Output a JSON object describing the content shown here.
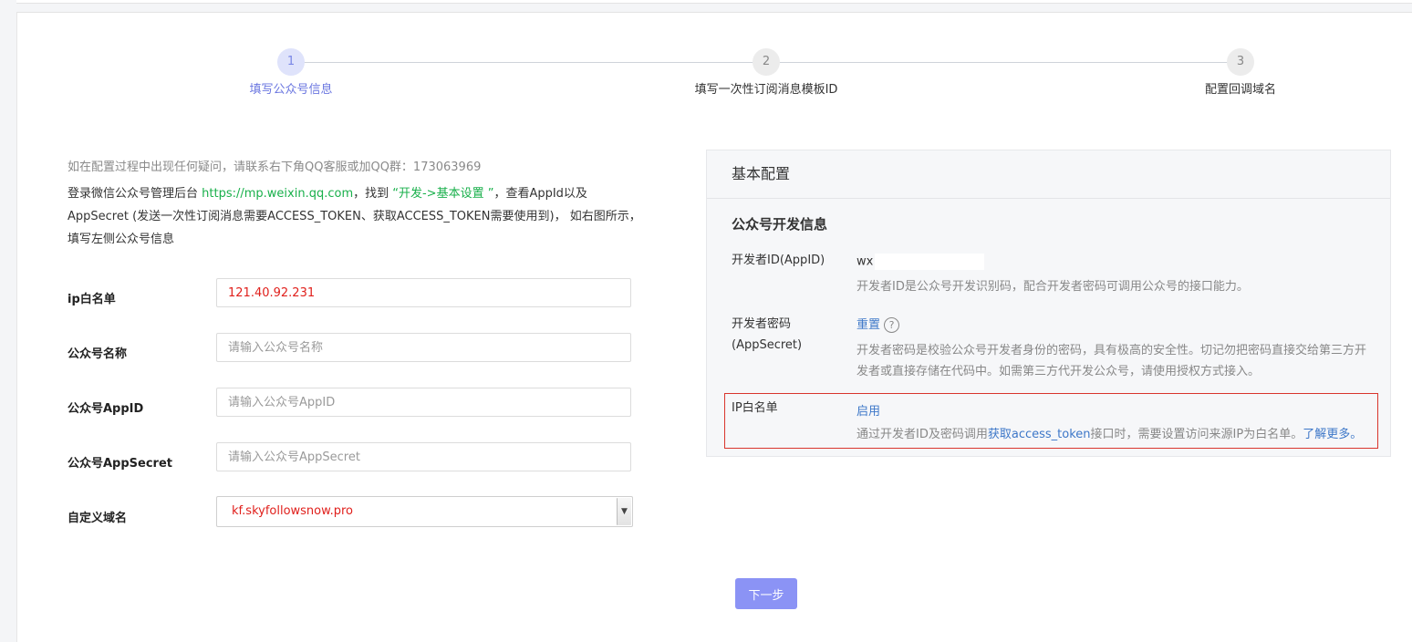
{
  "steps": [
    {
      "number": "1",
      "label": "填写公众号信息"
    },
    {
      "number": "2",
      "label": "填写一次性订阅消息模板ID"
    },
    {
      "number": "3",
      "label": "配置回调域名"
    }
  ],
  "help_text": "如在配置过程中出现任何疑问，请联系右下角QQ客服或加QQ群：173063969",
  "instructions": {
    "prefix": "登录微信公众号管理后台 ",
    "url": "https://mp.weixin.qq.com",
    "middle": "，找到 ",
    "path": "“开发->基本设置 ”",
    "suffix": "，查看AppId以及AppSecret (发送一次性订阅消息需要ACCESS_TOKEN、获取ACCESS_TOKEN需要使用到)， 如右图所示，填写左侧公众号信息"
  },
  "form": {
    "ip_whitelist": {
      "label": "ip白名单",
      "value": "121.40.92.231"
    },
    "account_name": {
      "label": "公众号名称",
      "placeholder": "请输入公众号名称"
    },
    "appid": {
      "label": "公众号AppID",
      "placeholder": "请输入公众号AppID"
    },
    "appsecret": {
      "label": "公众号AppSecret",
      "placeholder": "请输入公众号AppSecret"
    },
    "domain": {
      "label": "自定义域名",
      "value": "kf.skyfollowsnow.pro"
    }
  },
  "next_button": "下一步",
  "panel": {
    "title": "基本配置",
    "subtitle": "公众号开发信息",
    "appid": {
      "label": "开发者ID(AppID)",
      "value": "wx",
      "desc": "开发者ID是公众号开发识别码，配合开发者密码可调用公众号的接口能力。"
    },
    "secret": {
      "label_line1": "开发者密码",
      "label_line2": "(AppSecret)",
      "action": "重置",
      "help_icon": "?",
      "desc": "开发者密码是校验公众号开发者身份的密码，具有极高的安全性。切记勿把密码直接交给第三方开发者或直接存储在代码中。如需第三方代开发公众号，请使用授权方式接入。"
    },
    "ip": {
      "label": "IP白名单",
      "action": "启用",
      "desc_prefix": "通过开发者ID及密码调用",
      "desc_link": "获取access_token",
      "desc_suffix": "接口时，需要设置访问来源IP为白名单。",
      "learn_more": "了解更多。"
    }
  },
  "colors": {
    "accent": "#8b93f5",
    "active_step": "#6b77e0",
    "link_green": "#19b04b",
    "link_blue": "#3d77c8",
    "highlight_red": "#d9352d",
    "value_red": "#e0201c"
  }
}
